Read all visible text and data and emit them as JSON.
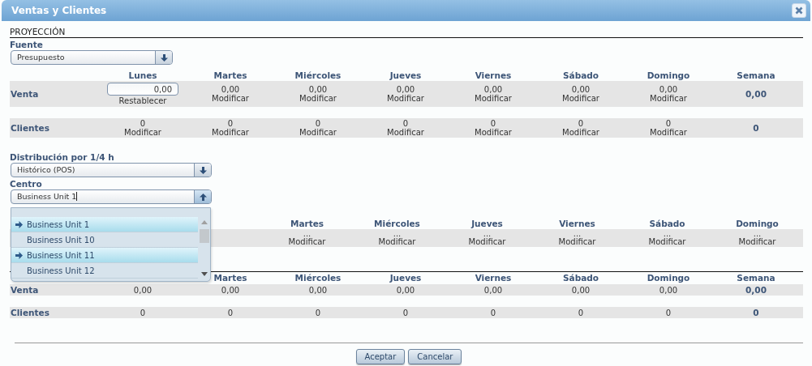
{
  "window": {
    "title": "Ventas y Clientes"
  },
  "section_title": "PROYECCIÓN",
  "fuente": {
    "label": "Fuente",
    "value": "Presupuesto",
    "expanded": false
  },
  "projection_table": {
    "columns": [
      "Lunes",
      "Martes",
      "Miércoles",
      "Jueves",
      "Viernes",
      "Sábado",
      "Domingo",
      "Semana"
    ],
    "rows": [
      {
        "label": "Venta",
        "cells": [
          {
            "kind": "input",
            "value": "0,00",
            "action": "Restablecer"
          },
          {
            "kind": "link",
            "value": "0,00",
            "action": "Modificar"
          },
          {
            "kind": "link",
            "value": "0,00",
            "action": "Modificar"
          },
          {
            "kind": "link",
            "value": "0,00",
            "action": "Modificar"
          },
          {
            "kind": "link",
            "value": "0,00",
            "action": "Modificar"
          },
          {
            "kind": "link",
            "value": "0,00",
            "action": "Modificar"
          },
          {
            "kind": "link",
            "value": "0,00",
            "action": "Modificar"
          },
          {
            "kind": "total",
            "value": "0,00"
          }
        ]
      },
      {
        "label": "Clientes",
        "cells": [
          {
            "kind": "link",
            "value": "0",
            "action": "Modificar"
          },
          {
            "kind": "link",
            "value": "0",
            "action": "Modificar"
          },
          {
            "kind": "link",
            "value": "0",
            "action": "Modificar"
          },
          {
            "kind": "link",
            "value": "0",
            "action": "Modificar"
          },
          {
            "kind": "link",
            "value": "0",
            "action": "Modificar"
          },
          {
            "kind": "link",
            "value": "0",
            "action": "Modificar"
          },
          {
            "kind": "link",
            "value": "0",
            "action": "Modificar"
          },
          {
            "kind": "total",
            "value": "0"
          }
        ]
      }
    ]
  },
  "distribution": {
    "label": "Distribución por 1/4 h",
    "value": "Histórico (POS)",
    "expanded": false
  },
  "centro": {
    "label": "Centro",
    "value": "Business Unit 1",
    "expanded": true,
    "options": [
      {
        "label": "Business Unit 1",
        "selected": true
      },
      {
        "label": "Business Unit 10",
        "selected": false
      },
      {
        "label": "Business Unit 11",
        "selected": true
      },
      {
        "label": "Business Unit 12",
        "selected": false
      }
    ]
  },
  "distribution_table": {
    "columns": [
      "",
      "Martes",
      "Miércoles",
      "Jueves",
      "Viernes",
      "Sábado",
      "Domingo"
    ],
    "rows": [
      {
        "cells": [
          {
            "kind": "empty"
          },
          {
            "kind": "link",
            "value": "...",
            "action": "Modificar"
          },
          {
            "kind": "link",
            "value": "...",
            "action": "Modificar"
          },
          {
            "kind": "link",
            "value": "...",
            "action": "Modificar"
          },
          {
            "kind": "link",
            "value": "...",
            "action": "Modificar"
          },
          {
            "kind": "link",
            "value": "...",
            "action": "Modificar"
          },
          {
            "kind": "link",
            "value": "...",
            "action": "Modificar"
          }
        ]
      }
    ]
  },
  "summary_table": {
    "columns": [
      "",
      "Martes",
      "Miércoles",
      "Jueves",
      "Viernes",
      "Sábado",
      "Domingo",
      "Semana"
    ],
    "rows": [
      {
        "label": "Venta",
        "cells": [
          {
            "kind": "plain",
            "value": "0,00"
          },
          {
            "kind": "plain",
            "value": "0,00"
          },
          {
            "kind": "plain",
            "value": "0,00"
          },
          {
            "kind": "plain",
            "value": "0,00"
          },
          {
            "kind": "plain",
            "value": "0,00"
          },
          {
            "kind": "plain",
            "value": "0,00"
          },
          {
            "kind": "plain",
            "value": "0,00"
          },
          {
            "kind": "total",
            "value": "0,00"
          }
        ]
      },
      {
        "label": "Clientes",
        "cells": [
          {
            "kind": "plain",
            "value": "0"
          },
          {
            "kind": "plain",
            "value": "0"
          },
          {
            "kind": "plain",
            "value": "0"
          },
          {
            "kind": "plain",
            "value": "0"
          },
          {
            "kind": "plain",
            "value": "0"
          },
          {
            "kind": "plain",
            "value": "0"
          },
          {
            "kind": "plain",
            "value": "0"
          },
          {
            "kind": "total",
            "value": "0"
          }
        ]
      }
    ]
  },
  "buttons": [
    "Aceptar",
    "Cancelar"
  ]
}
